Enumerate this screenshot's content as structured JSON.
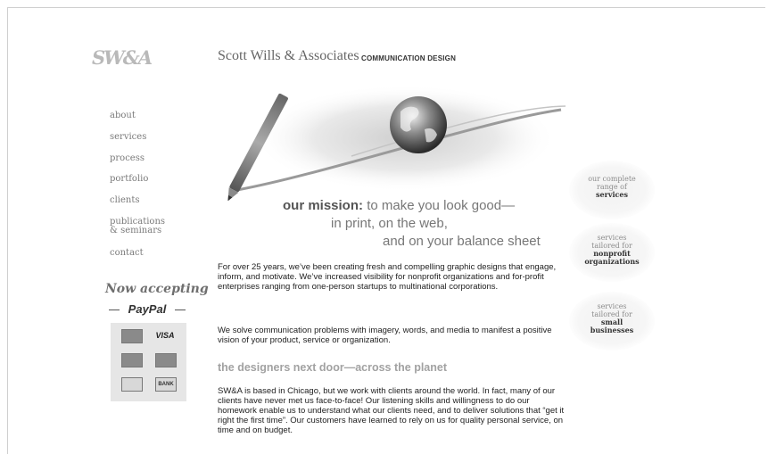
{
  "header": {
    "logo": "SW&A",
    "firm_name": "Scott Wills & Associates",
    "tagline": "COMMUNICATION DESIGN"
  },
  "nav": {
    "items": [
      {
        "label": "about"
      },
      {
        "label": "services"
      },
      {
        "label": "process"
      },
      {
        "label": "portfolio"
      },
      {
        "label": "clients"
      },
      {
        "label": "publications",
        "label2": "& seminars"
      },
      {
        "label": "contact"
      }
    ]
  },
  "payments": {
    "title": "Now accepting",
    "paypal": "PayPal",
    "cards": [
      "MasterCard",
      "VISA",
      "AMEX",
      "Discover",
      "eCheck",
      "BANK"
    ]
  },
  "mission": {
    "lead": "our mission:",
    "line1": "to make you look good—",
    "line2": "in print, on the web,",
    "line3": "and on your balance sheet"
  },
  "content": {
    "para1": "For over 25 years, we’ve been creating fresh and compelling graphic designs that engage, inform, and motivate. We’ve increased visibility for nonprofit organizations and for-profit enterprises ranging from one-person startups to multinational corporations.",
    "para2": "We solve communication problems with imagery, words, and media to manifest a positive vision of your product, service or organization.",
    "subhead": "the designers next door—across the planet",
    "para3": "SW&A is based in Chicago, but we work with clients around the world. In fact, many of our clients have never met us face-to-face! Our listening skills and willingness to do our homework enable us to understand what our clients need, and to deliver solutions that “get it right the first time”. Our customers have learned to rely on us for quality personal service, on time and on budget."
  },
  "bubbles": [
    {
      "light1": "our complete",
      "light2": "range of",
      "bold1": "services",
      "bold2": ""
    },
    {
      "light1": "services",
      "light2": "tailored for",
      "bold1": "nonprofit",
      "bold2": "organizations"
    },
    {
      "light1": "services",
      "light2": "tailored for",
      "bold1": "small",
      "bold2": "businesses"
    }
  ],
  "colors": {
    "background": "#ffffff",
    "text": "#222222",
    "muted": "#777777",
    "subhead": "#a2a2a2"
  }
}
